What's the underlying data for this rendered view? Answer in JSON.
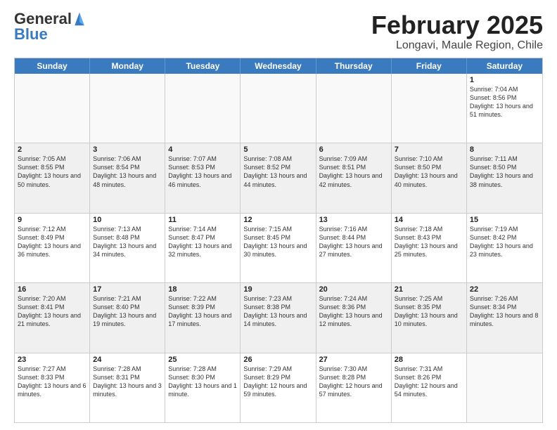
{
  "header": {
    "logo": "GeneralBlue",
    "month": "February 2025",
    "location": "Longavi, Maule Region, Chile"
  },
  "weekdays": [
    "Sunday",
    "Monday",
    "Tuesday",
    "Wednesday",
    "Thursday",
    "Friday",
    "Saturday"
  ],
  "rows": [
    [
      {
        "day": "",
        "info": ""
      },
      {
        "day": "",
        "info": ""
      },
      {
        "day": "",
        "info": ""
      },
      {
        "day": "",
        "info": ""
      },
      {
        "day": "",
        "info": ""
      },
      {
        "day": "",
        "info": ""
      },
      {
        "day": "1",
        "info": "Sunrise: 7:04 AM\nSunset: 8:56 PM\nDaylight: 13 hours and 51 minutes."
      }
    ],
    [
      {
        "day": "2",
        "info": "Sunrise: 7:05 AM\nSunset: 8:55 PM\nDaylight: 13 hours and 50 minutes."
      },
      {
        "day": "3",
        "info": "Sunrise: 7:06 AM\nSunset: 8:54 PM\nDaylight: 13 hours and 48 minutes."
      },
      {
        "day": "4",
        "info": "Sunrise: 7:07 AM\nSunset: 8:53 PM\nDaylight: 13 hours and 46 minutes."
      },
      {
        "day": "5",
        "info": "Sunrise: 7:08 AM\nSunset: 8:52 PM\nDaylight: 13 hours and 44 minutes."
      },
      {
        "day": "6",
        "info": "Sunrise: 7:09 AM\nSunset: 8:51 PM\nDaylight: 13 hours and 42 minutes."
      },
      {
        "day": "7",
        "info": "Sunrise: 7:10 AM\nSunset: 8:50 PM\nDaylight: 13 hours and 40 minutes."
      },
      {
        "day": "8",
        "info": "Sunrise: 7:11 AM\nSunset: 8:50 PM\nDaylight: 13 hours and 38 minutes."
      }
    ],
    [
      {
        "day": "9",
        "info": "Sunrise: 7:12 AM\nSunset: 8:49 PM\nDaylight: 13 hours and 36 minutes."
      },
      {
        "day": "10",
        "info": "Sunrise: 7:13 AM\nSunset: 8:48 PM\nDaylight: 13 hours and 34 minutes."
      },
      {
        "day": "11",
        "info": "Sunrise: 7:14 AM\nSunset: 8:47 PM\nDaylight: 13 hours and 32 minutes."
      },
      {
        "day": "12",
        "info": "Sunrise: 7:15 AM\nSunset: 8:45 PM\nDaylight: 13 hours and 30 minutes."
      },
      {
        "day": "13",
        "info": "Sunrise: 7:16 AM\nSunset: 8:44 PM\nDaylight: 13 hours and 27 minutes."
      },
      {
        "day": "14",
        "info": "Sunrise: 7:18 AM\nSunset: 8:43 PM\nDaylight: 13 hours and 25 minutes."
      },
      {
        "day": "15",
        "info": "Sunrise: 7:19 AM\nSunset: 8:42 PM\nDaylight: 13 hours and 23 minutes."
      }
    ],
    [
      {
        "day": "16",
        "info": "Sunrise: 7:20 AM\nSunset: 8:41 PM\nDaylight: 13 hours and 21 minutes."
      },
      {
        "day": "17",
        "info": "Sunrise: 7:21 AM\nSunset: 8:40 PM\nDaylight: 13 hours and 19 minutes."
      },
      {
        "day": "18",
        "info": "Sunrise: 7:22 AM\nSunset: 8:39 PM\nDaylight: 13 hours and 17 minutes."
      },
      {
        "day": "19",
        "info": "Sunrise: 7:23 AM\nSunset: 8:38 PM\nDaylight: 13 hours and 14 minutes."
      },
      {
        "day": "20",
        "info": "Sunrise: 7:24 AM\nSunset: 8:36 PM\nDaylight: 13 hours and 12 minutes."
      },
      {
        "day": "21",
        "info": "Sunrise: 7:25 AM\nSunset: 8:35 PM\nDaylight: 13 hours and 10 minutes."
      },
      {
        "day": "22",
        "info": "Sunrise: 7:26 AM\nSunset: 8:34 PM\nDaylight: 13 hours and 8 minutes."
      }
    ],
    [
      {
        "day": "23",
        "info": "Sunrise: 7:27 AM\nSunset: 8:33 PM\nDaylight: 13 hours and 6 minutes."
      },
      {
        "day": "24",
        "info": "Sunrise: 7:28 AM\nSunset: 8:31 PM\nDaylight: 13 hours and 3 minutes."
      },
      {
        "day": "25",
        "info": "Sunrise: 7:28 AM\nSunset: 8:30 PM\nDaylight: 13 hours and 1 minute."
      },
      {
        "day": "26",
        "info": "Sunrise: 7:29 AM\nSunset: 8:29 PM\nDaylight: 12 hours and 59 minutes."
      },
      {
        "day": "27",
        "info": "Sunrise: 7:30 AM\nSunset: 8:28 PM\nDaylight: 12 hours and 57 minutes."
      },
      {
        "day": "28",
        "info": "Sunrise: 7:31 AM\nSunset: 8:26 PM\nDaylight: 12 hours and 54 minutes."
      },
      {
        "day": "",
        "info": ""
      }
    ]
  ]
}
